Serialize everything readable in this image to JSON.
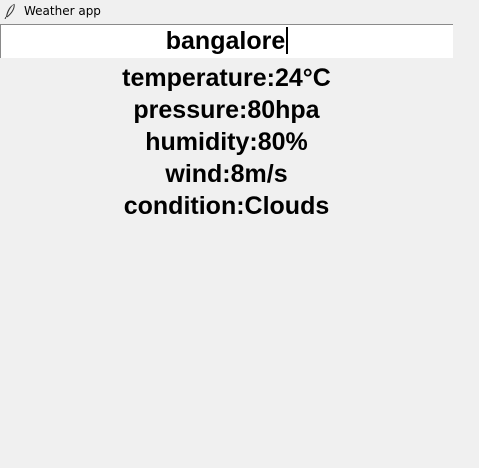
{
  "window": {
    "title": "Weather app",
    "icon": "feather-icon"
  },
  "search": {
    "value": "bangalore"
  },
  "weather": {
    "temperature": "temperature:24°C",
    "pressure": "pressure:80hpa",
    "humidity": "humidity:80%",
    "wind": "wind:8m/s",
    "condition": "condition:Clouds"
  }
}
